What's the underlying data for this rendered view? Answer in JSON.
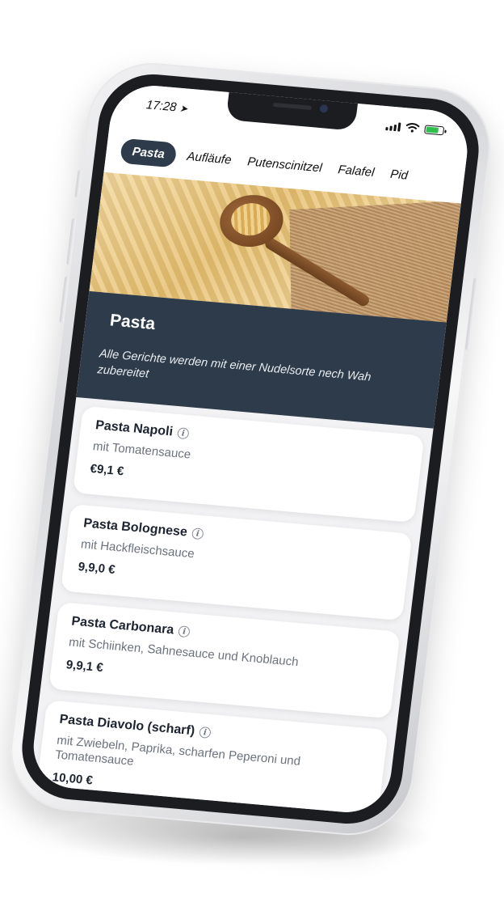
{
  "status_bar": {
    "time": "17:28",
    "location_glyph": "➤",
    "battery_level": 0.8,
    "battery_color": "#2fbf4a"
  },
  "tabs": [
    {
      "label": "Pasta",
      "active": true
    },
    {
      "label": "Aufläufe",
      "active": false
    },
    {
      "label": "Putenscinitzel",
      "active": false
    },
    {
      "label": "Falafel",
      "active": false
    },
    {
      "label": "Pid",
      "active": false
    }
  ],
  "category": {
    "title": "Pasta",
    "description": "Alle Gerichte werden mit einer Nudelsorte nech Wah zubereitet",
    "banner_color": "#2e3b4a"
  },
  "items": [
    {
      "name": "Pasta Napoli",
      "description": "mit Tomatensauce",
      "price": "€9,1 €"
    },
    {
      "name": "Pasta Bolognese",
      "description": "mit Hackfleischsauce",
      "price": "9,9,0 €"
    },
    {
      "name": "Pasta Carbonara",
      "description": "mit Schiinken, Sahnesauce und Knoblauch",
      "price": "9,9,1 €"
    },
    {
      "name": "Pasta Diavolo (scharf)",
      "description": "mit Zwiebeln, Paprika, scharfen Peperoni und Tomatensauce",
      "price": "10,00 €"
    }
  ],
  "icons": {
    "info": "info-icon",
    "location": "location-arrow-icon",
    "signal": "cellular-signal-icon",
    "wifi": "wifi-icon",
    "battery": "battery-icon"
  }
}
